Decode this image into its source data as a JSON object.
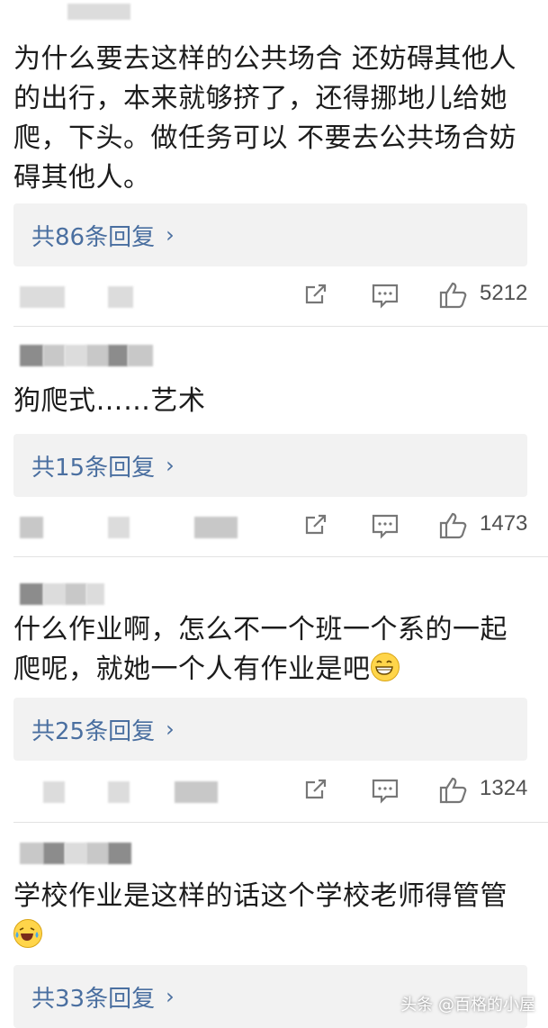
{
  "comments": [
    {
      "text": "为什么要去这样的公共场合 还妨碍其他人的出行，本来就够挤了，还得挪地儿给她爬，下头。做任务可以 不要去公共场合妨碍其他人。",
      "replies_label": "共86条回复",
      "likes": "5212"
    },
    {
      "text": "狗爬式……艺术",
      "replies_label": "共15条回复",
      "likes": "1473"
    },
    {
      "text": "什么作业啊，怎么不一个班一个系的一起爬呢，就她一个人有作业是吧",
      "replies_label": "共25条回复",
      "likes": "1324"
    },
    {
      "text": "学校作业是这样的话这个学校老师得管管",
      "replies_label": "共33条回复"
    }
  ],
  "icons": {
    "share": "share-icon",
    "comment": "comment-icon",
    "like": "thumbs-up-icon",
    "chevron": "chevron-right-icon"
  },
  "colors": {
    "reply_link": "#4a6fa0",
    "reply_bg": "#f2f2f2",
    "icon_gray": "#7a7a7a"
  },
  "watermark": "头条 @百格的小屋"
}
